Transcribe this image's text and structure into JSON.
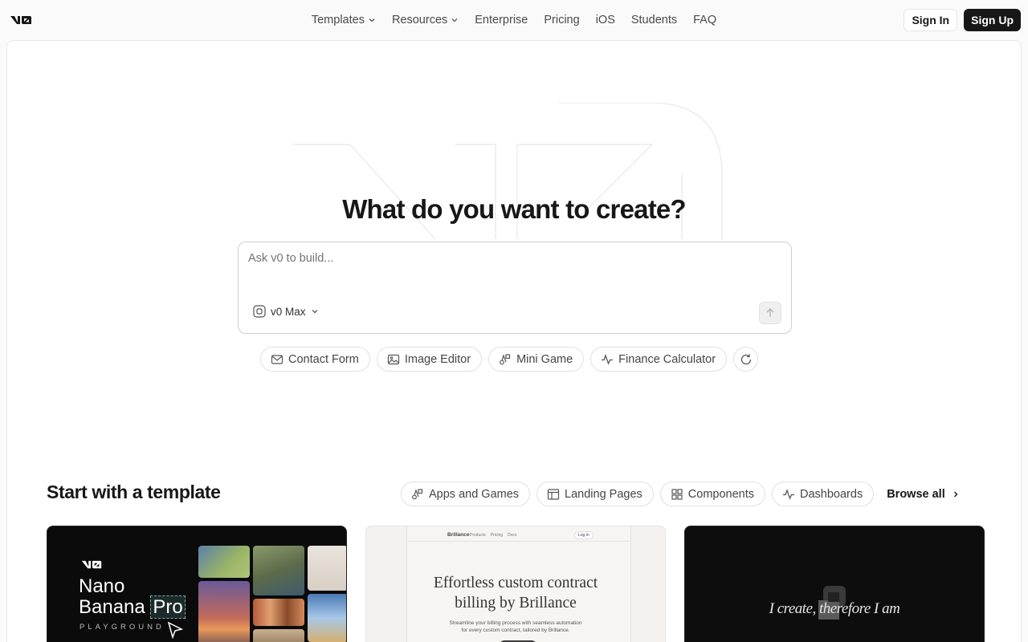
{
  "nav": {
    "items": [
      {
        "label": "Templates",
        "dropdown": true
      },
      {
        "label": "Resources",
        "dropdown": true
      },
      {
        "label": "Enterprise",
        "dropdown": false
      },
      {
        "label": "Pricing",
        "dropdown": false
      },
      {
        "label": "iOS",
        "dropdown": false
      },
      {
        "label": "Students",
        "dropdown": false
      },
      {
        "label": "FAQ",
        "dropdown": false
      }
    ],
    "sign_in": "Sign In",
    "sign_up": "Sign Up"
  },
  "hero": {
    "title": "What do you want to create?",
    "prompt_placeholder": "Ask v0 to build...",
    "model": "v0 Max"
  },
  "suggestions": [
    "Contact Form",
    "Image Editor",
    "Mini Game",
    "Finance Calculator"
  ],
  "templates": {
    "title": "Start with a template",
    "filters": [
      "Apps and Games",
      "Landing Pages",
      "Components",
      "Dashboards"
    ],
    "browse_all": "Browse all",
    "cards": [
      {
        "line1": "Nano",
        "line2": "Banana",
        "badge": "Pro",
        "sub": "PLAYGROUND"
      },
      {
        "brand": "Brillance",
        "nav": [
          "Products",
          "Pricing",
          "Docs"
        ],
        "login": "Log in",
        "heading1": "Effortless custom contract",
        "heading2": "billing by Brillance",
        "sub1": "Streamline your billing process with seamless automation",
        "sub2": "for every custom contract, tailored by Brillance."
      },
      {
        "text": "I create, therefore I am"
      }
    ]
  },
  "colors": {
    "primary": "#171717",
    "muted": "#737373",
    "border": "#e5e5e5"
  }
}
